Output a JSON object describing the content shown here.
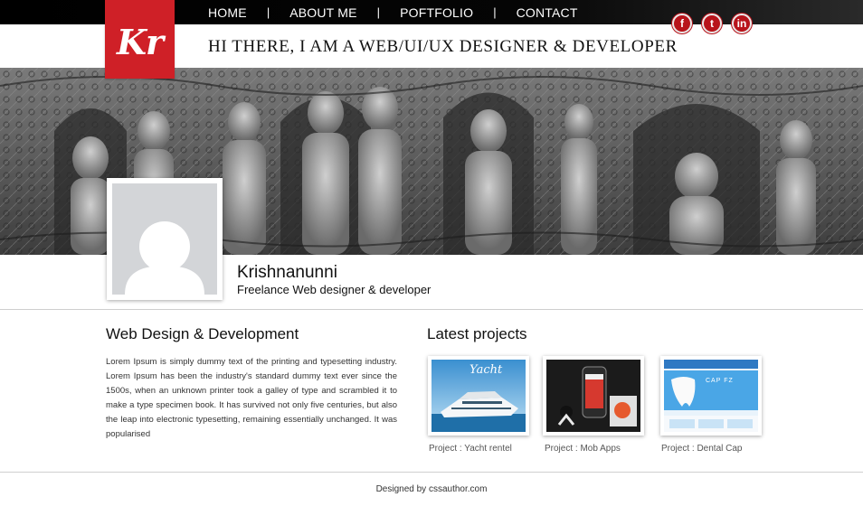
{
  "nav": {
    "items": [
      {
        "label": "HOME"
      },
      {
        "label": "ABOUT ME"
      },
      {
        "label": "POFTFOLIO"
      },
      {
        "label": "CONTACT"
      }
    ],
    "separator": "|"
  },
  "logo": {
    "text": "Kr",
    "color": "#cf2027"
  },
  "header": {
    "tagline": "HI THERE,  I AM A WEB/UI/UX DESIGNER & DEVELOPER"
  },
  "social": [
    {
      "icon": "facebook-icon",
      "glyph": "f"
    },
    {
      "icon": "twitter-icon",
      "glyph": "t"
    },
    {
      "icon": "linkedin-icon",
      "glyph": "in"
    }
  ],
  "profile": {
    "name": "Krishnanunni",
    "role": "Freelance Web designer & developer"
  },
  "about": {
    "title": "Web Design & Development",
    "body": "Lorem Ipsum is simply dummy text of the printing and typesetting industry. Lorem Ipsum has been the industry's standard dummy text ever since the 1500s, when an unknown printer took a galley of type and scrambled it to make a type specimen book. It has survived not only five centuries, but also the leap into electronic typesetting, remaining essentially unchanged. It was popularised"
  },
  "projects": {
    "title": "Latest projects",
    "items": [
      {
        "label": "Project : Yacht rentel",
        "thumb_text": "Yacht"
      },
      {
        "label": "Project : Mob Apps"
      },
      {
        "label": "Project : Dental Cap",
        "thumb_text": "CAP FZ"
      }
    ]
  },
  "footer": {
    "text": "Designed by cssauthor.com"
  },
  "colors": {
    "accent": "#cf2027",
    "nav_bg": "#000000",
    "social_red": "#b8141b"
  }
}
